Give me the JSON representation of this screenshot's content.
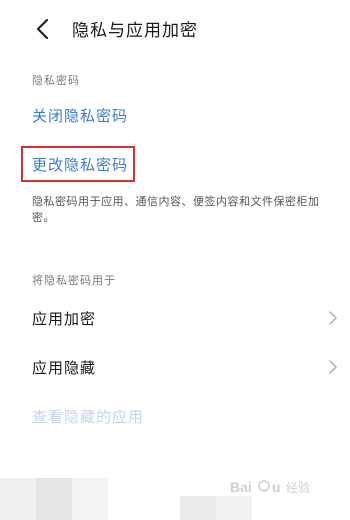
{
  "header": {
    "back_icon": "chevron-left-icon",
    "title": "隐私与应用加密"
  },
  "privacy_password_section": {
    "label": "隐私密码",
    "close_link": "关闭隐私密码",
    "change_link": "更改隐私密码",
    "description": "隐私密码用于应用、通信内容、便签内容和文件保密柜加密。"
  },
  "use_for_section": {
    "label": "将隐私密码用于",
    "rows": [
      {
        "label": "应用加密",
        "icon": "chevron-right-icon"
      },
      {
        "label": "应用隐藏",
        "icon": "chevron-right-icon"
      }
    ],
    "view_hidden_link": "查看隐藏的应用"
  },
  "colors": {
    "accent_blue": "#3a7bd5",
    "highlight_red": "#e03030",
    "disabled_blue": "#c4d4ee"
  },
  "watermark": {
    "text": "Baidu 经验"
  }
}
